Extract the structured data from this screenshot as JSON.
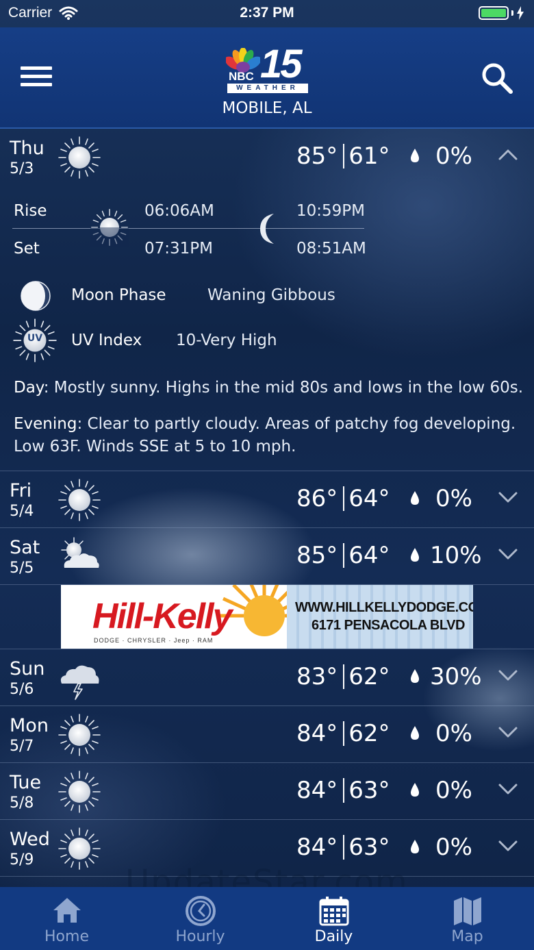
{
  "status_bar": {
    "carrier": "Carrier",
    "time": "2:37 PM"
  },
  "header": {
    "location": "MOBILE, AL",
    "logo_nbc": "NBC",
    "logo_number": "15",
    "logo_weather": "WEATHER"
  },
  "days": [
    {
      "name": "Thu",
      "date": "5/3",
      "icon": "sun-icon",
      "high": "85°",
      "low": "61°",
      "precip": "0%",
      "expanded": true
    },
    {
      "name": "Fri",
      "date": "5/4",
      "icon": "sun-icon",
      "high": "86°",
      "low": "64°",
      "precip": "0%"
    },
    {
      "name": "Sat",
      "date": "5/5",
      "icon": "partly-cloudy-icon",
      "high": "85°",
      "low": "64°",
      "precip": "10%"
    },
    {
      "name": "Sun",
      "date": "5/6",
      "icon": "thunderstorm-icon",
      "high": "83°",
      "low": "62°",
      "precip": "30%"
    },
    {
      "name": "Mon",
      "date": "5/7",
      "icon": "sun-icon",
      "high": "84°",
      "low": "62°",
      "precip": "0%"
    },
    {
      "name": "Tue",
      "date": "5/8",
      "icon": "sun-icon",
      "high": "84°",
      "low": "63°",
      "precip": "0%"
    },
    {
      "name": "Wed",
      "date": "5/9",
      "icon": "sun-icon",
      "high": "84°",
      "low": "63°",
      "precip": "0%"
    }
  ],
  "details": {
    "rise_label": "Rise",
    "set_label": "Set",
    "sunrise": "06:06AM",
    "sunset": "07:31PM",
    "moonrise": "10:59PM",
    "moonset": "08:51AM",
    "moon_phase_label": "Moon Phase",
    "moon_phase_value": "Waning Gibbous",
    "uv_label": "UV Index",
    "uv_icon_text": "UV",
    "uv_value": "10-Very High",
    "day_label": "Day",
    "day_text": ": Mostly sunny. Highs in the mid 80s and lows in the low 60s.",
    "evening_label": "Evening",
    "evening_text": ": Clear to partly cloudy. Areas of patchy fog developing. Low 63F. Winds SSE at 5 to 10 mph."
  },
  "ad": {
    "brand": "Hill-Kelly",
    "url": "WWW.HILLKELLYDODGE.COM",
    "address": "6171 PENSACOLA BLVD",
    "sub": "DODGE · CHRYSLER · Jeep · RAM"
  },
  "watermark": "UpdateStar.com",
  "tabs": [
    {
      "label": "Home",
      "icon": "home-icon"
    },
    {
      "label": "Hourly",
      "icon": "clock-icon"
    },
    {
      "label": "Daily",
      "icon": "calendar-icon",
      "active": true
    },
    {
      "label": "Map",
      "icon": "map-icon"
    }
  ],
  "colors": {
    "header": "#163e86",
    "tabbar": "#123a82",
    "battery": "#4cd964",
    "ad_red": "#d71920"
  }
}
